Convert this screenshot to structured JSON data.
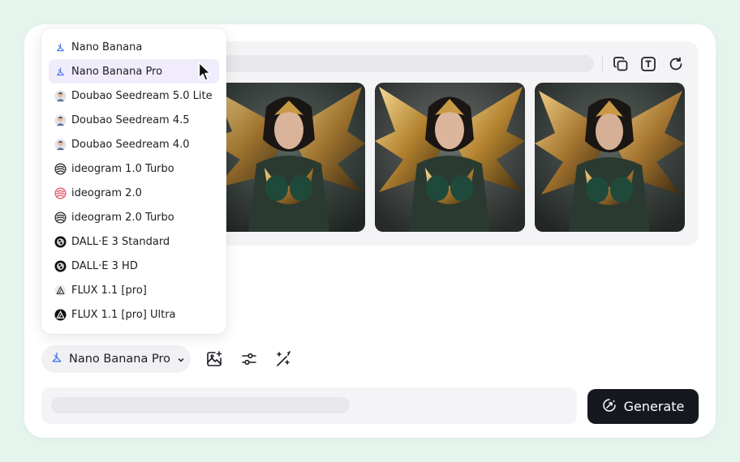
{
  "model_menu": {
    "items": [
      {
        "label": "Nano Banana",
        "icon": "nano-banana-icon",
        "selected": false
      },
      {
        "label": "Nano Banana Pro",
        "icon": "nano-banana-icon",
        "selected": true
      },
      {
        "label": "Doubao Seedream 5.0 Lite",
        "icon": "doubao-icon",
        "selected": false
      },
      {
        "label": "Doubao Seedream 4.5",
        "icon": "doubao-icon",
        "selected": false
      },
      {
        "label": "Doubao Seedream 4.0",
        "icon": "doubao-icon",
        "selected": false
      },
      {
        "label": "ideogram 1.0 Turbo",
        "icon": "ideogram-icon",
        "selected": false
      },
      {
        "label": "ideogram 2.0",
        "icon": "ideogram-red-icon",
        "selected": false
      },
      {
        "label": "ideogram 2.0 Turbo",
        "icon": "ideogram-icon",
        "selected": false
      },
      {
        "label": "DALL·E 3 Standard",
        "icon": "openai-icon",
        "selected": false
      },
      {
        "label": "DALL·E 3 HD",
        "icon": "openai-icon",
        "selected": false
      },
      {
        "label": "FLUX 1.1 [pro]",
        "icon": "flux-icon",
        "selected": false
      },
      {
        "label": "FLUX 1.1 [pro] Ultra",
        "icon": "flux-dark-icon",
        "selected": false
      }
    ]
  },
  "toolbar": {
    "model_selector_label": "Nano Banana Pro",
    "generate_label": "Generate"
  },
  "result_actions": [
    "copy-icon",
    "text-icon",
    "refresh-icon"
  ],
  "colors": {
    "background": "#e6f4ee",
    "selected_item": "#f1ecfb",
    "generate_button": "#15181f",
    "accent_blue": "#4a7bf0"
  }
}
